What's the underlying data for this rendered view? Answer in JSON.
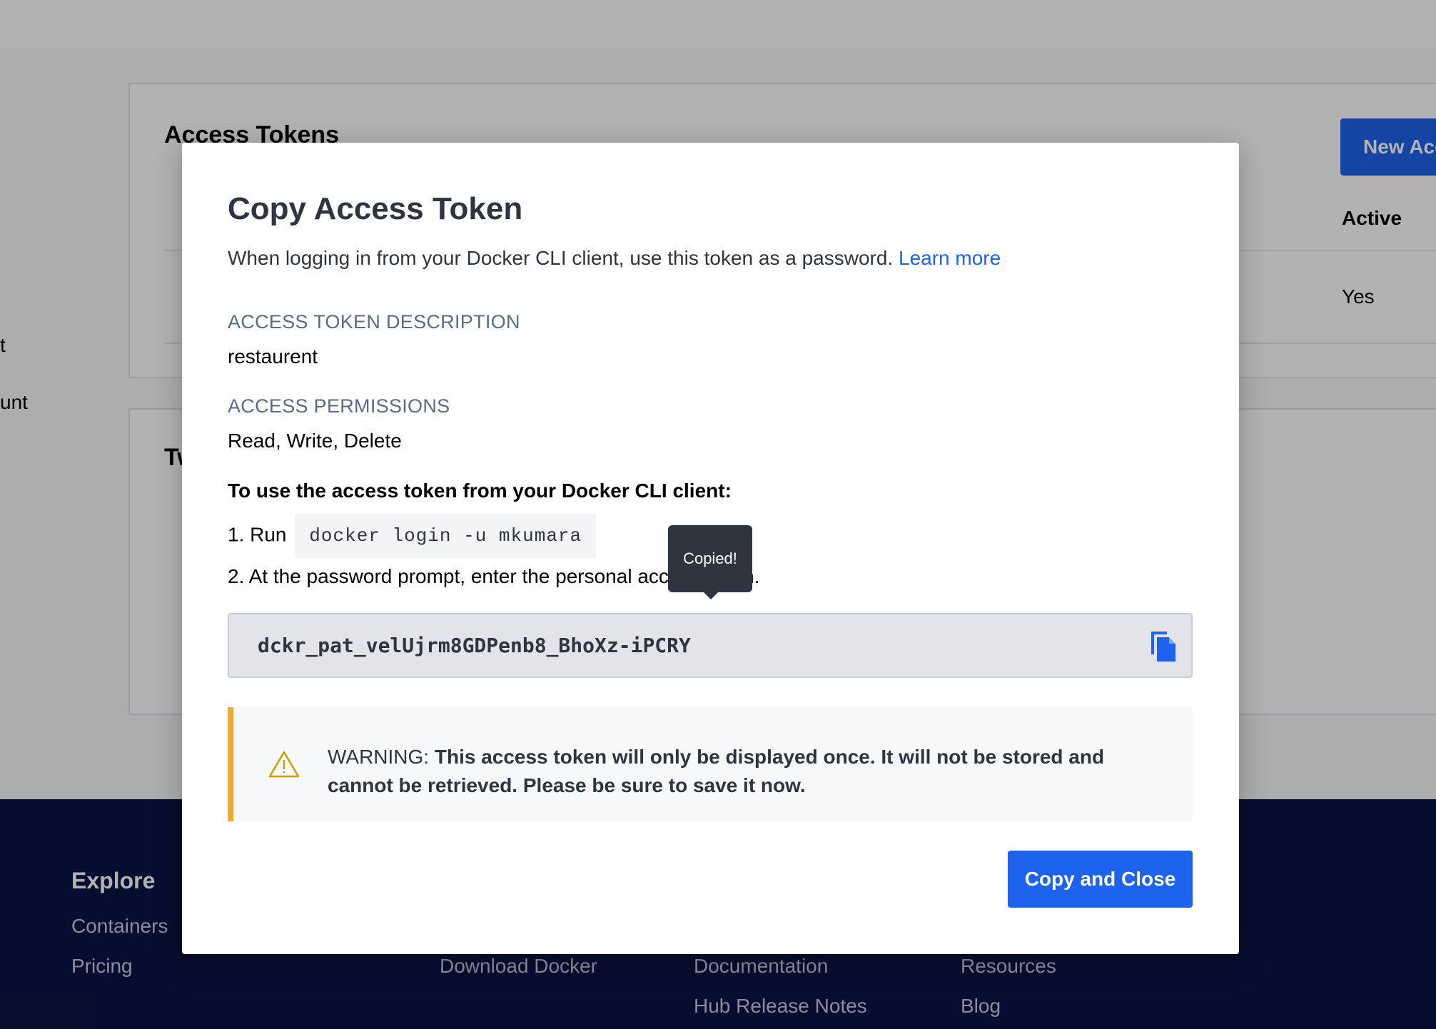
{
  "background": {
    "tokens_card": {
      "title": "Access Tokens",
      "new_button_label": "New Acc",
      "column_active": "Active",
      "row_active_value": "Yes"
    },
    "twofa_card": {
      "title_fragment": "Tw"
    },
    "sidebar_fragments": [
      "t",
      "unt"
    ]
  },
  "footer": {
    "explore_heading": "Explore",
    "links": {
      "containers": "Containers",
      "pricing": "Pricing",
      "download_docker": "Download Docker",
      "documentation": "Documentation",
      "hub_release_notes": "Hub Release Notes",
      "resources": "Resources",
      "blog": "Blog"
    }
  },
  "modal": {
    "title": "Copy Access Token",
    "subtitle": "When logging in from your Docker CLI client, use this token as a password.",
    "learn_more": "Learn more",
    "description_label": "ACCESS TOKEN DESCRIPTION",
    "description_value": "restaurent",
    "permissions_label": "ACCESS PERMISSIONS",
    "permissions_value": "Read, Write, Delete",
    "instructions_heading": "To use the access token from your Docker CLI client:",
    "step1_prefix": "1. Run",
    "step1_command": "docker login -u mkumara",
    "step2_text": "2. At the password prompt, enter the personal access token.",
    "tooltip": "Copied!",
    "token": "dckr_pat_velUjrm8GDPenb8_BhoXz-iPCRY",
    "warning_prefix": "WARNING:",
    "warning_text": "This access token will only be displayed once. It will not be stored and cannot be retrieved. Please be sure to save it now.",
    "copy_close_label": "Copy and Close"
  },
  "colors": {
    "primary": "#1d63ed",
    "warning_accent": "#f5a72e",
    "footer_bg": "#0b1445",
    "overlay": "rgba(0,0,0,0.30)"
  },
  "icons": {
    "copy": "copy-icon",
    "warning": "warning-triangle-icon"
  }
}
